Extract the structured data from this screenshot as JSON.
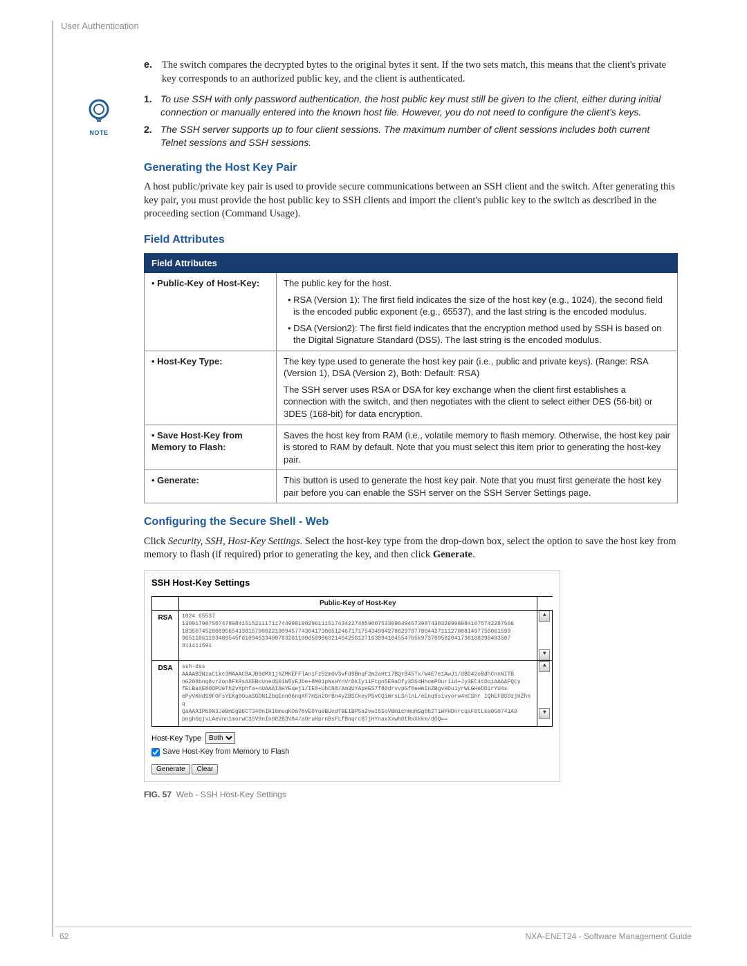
{
  "header": {
    "section": "User Authentication"
  },
  "para_e": {
    "label": "e.",
    "text": "The switch compares the decrypted bytes to the original bytes it sent. If the two sets match, this means that the client's private key corresponds to an authorized public key, and the client is authenticated."
  },
  "note": {
    "label": "NOTE",
    "items": [
      {
        "n": "1.",
        "t": "To use SSH with only password authentication, the host public key must still be given to the client, either during initial connection or manually entered into the known host file. However, you do not need to configure the client's keys."
      },
      {
        "n": "2.",
        "t": "The SSH server supports up to four client sessions. The maximum number of client sessions includes both current Telnet sessions and SSH sessions."
      }
    ]
  },
  "h_gen": "Generating the Host Key Pair",
  "p_gen": "A host public/private key pair is used to provide secure communications between an SSH client and the switch. After generating this key pair, you must provide the host public key to SSH clients and import the client's public key to the switch as described in the proceeding section (Command Usage).",
  "h_fa": "Field Attributes",
  "fa_table": {
    "header": "Field Attributes",
    "rows": [
      {
        "k": "•  Public-Key of Host-Key:",
        "v_main": "The public key for the host.",
        "v_b1": "• RSA (Version 1): The first field indicates the size of the host key (e.g., 1024), the second field is the encoded public exponent (e.g., 65537), and the last string is the encoded modulus.",
        "v_b2": "• DSA (Version2): The first field indicates that the encryption method used by SSH is based on the Digital Signature Standard (DSS). The last string is the encoded modulus."
      },
      {
        "k": "•  Host-Key Type:",
        "v_main": "The key type used to generate the host key pair (i.e., public and private keys). (Range: RSA (Version 1), DSA (Version 2), Both: Default: RSA)",
        "v_b1": "The SSH server uses RSA or DSA for key exchange when the client first establishes a connection with the switch, and then negotiates with the client to select either DES (56-bit) or 3DES (168-bit) for data encryption.",
        "v_b2": ""
      },
      {
        "k": "•  Save Host-Key from Memory to Flash:",
        "v_main": "Saves the host key from RAM (i.e., volatile memory to flash memory. Otherwise, the host key pair is stored to RAM by default. Note that you must select this item prior to generating the host-key pair.",
        "v_b1": "",
        "v_b2": ""
      },
      {
        "k": "•  Generate:",
        "v_main": "This button is used to generate the host key pair. Note that you must first generate the host key pair before you can enable the SSH server on the SSH Server Settings page.",
        "v_b1": "",
        "v_b2": ""
      }
    ]
  },
  "h_cfg": "Configuring the Secure Shell - Web",
  "p_cfg_pre": "Click ",
  "p_cfg_ital": "Security, SSH, Host-Key Settings",
  "p_cfg_mid": ". Select the host-key type from the drop-down box, select the option to save the host key from memory to flash (if required) prior to generating the key, and then click ",
  "p_cfg_bold": "Generate",
  "p_cfg_end": ".",
  "figure": {
    "title": "SSH Host-Key Settings",
    "col_header": "Public-Key of Host-Key",
    "rsa_label": "RSA",
    "rsa_text": "1024 65537\n1309179875074789841515211171174499819029611151743422748590075330984945739874303299989841075742287566\n183507452808956541381579002219094577430417306512467171754349942786297877804427111270881497750061599\n96511861193489545fd1094633408783261100d589860214642561271630941845547b5k973789582041738188398483507\n811411591",
    "dsa_label": "DSA",
    "dsa_text": "ssh-dss\nAAAAB3NzaC1kc3MAAACBAJB9dMX1jhZMKEFFlAn1Fz92m0V3vFd9BnqF2m2aHt17BQrB45Tx/W4E7e1AwJ1/dBD42oBdhCnnNITB\nnG208bnq8vr2on8FkRsAXEBcUnedS01W5yEJDe+8M01pNsHYnVrDkIy11Ftgn5E9aOfy3DS4HhomPOuriid+Jy3EC4tDq1AAAAFQCy\nfELBaXE80OPUeTh2vXphfa+nUAAAIAHYEqeji/IE0+UhCN8/Am3UYApHES7f80drvvpGf0eHmInZBgvHDu1yrWLGHeDDirYU4s\nePyVKHdS9FOFsYEKg0OuaSGON1ZbqEnn06nqXF7mSn2OrBn4yZBSCkeyPSvCQimrsLSnlnL/eEnq9sivyorw4nCShr IQhEFBSOzjHZhnq\nQaAAAIPb9N3JeBmSgB6CT340nIH16muqKOa78vE0YueBUodTBEIBP5a2vwI5SoVBmichmUmSg0b2TiWYHDnrcqaF0tLke0G0741A9\npngh0qjvLAeVnn1morwC35V9nIn082B3V84/aOruHprnBsFLfBnqrc87jHYnaxXxwhOtRxXkkm/dOQ==",
    "hk_label": "Host-Key Type",
    "hk_value": "Both",
    "chk_label": "Save Host-Key from Memory to Flash",
    "btn_gen": "Generate",
    "btn_clr": "Clear"
  },
  "caption": {
    "figno": "FIG. 57",
    "text": "Web - SSH Host-Key Settings"
  },
  "footer": {
    "page": "62",
    "doc": "NXA-ENET24 - Software Management Guide"
  }
}
